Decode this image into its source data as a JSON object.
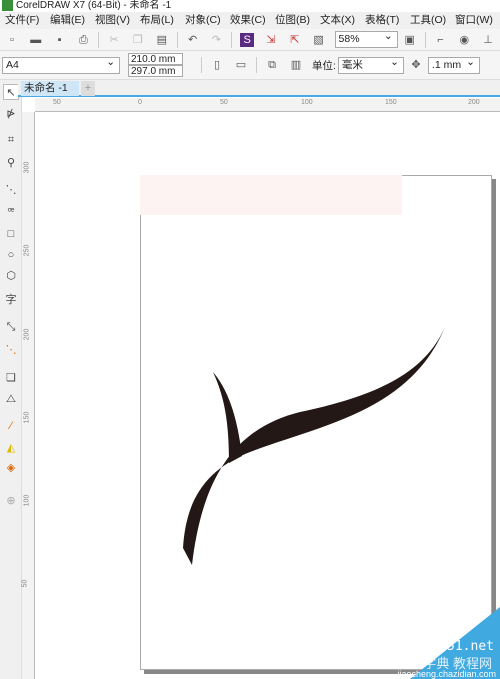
{
  "window": {
    "title": "CorelDRAW X7 (64-Bit) - 未命名 -1"
  },
  "menu": [
    "文件(F)",
    "编辑(E)",
    "视图(V)",
    "布局(L)",
    "对象(C)",
    "效果(C)",
    "位图(B)",
    "文本(X)",
    "表格(T)",
    "工具(O)",
    "窗口(W)"
  ],
  "toolbar": {
    "zoom": "58%"
  },
  "propbar": {
    "page_size": "A4",
    "width": "210.0 mm",
    "height": "297.0 mm",
    "unit_label": "单位:",
    "unit": "毫米",
    "nudge": ".1 mm"
  },
  "tabs": [
    {
      "label": "未命名 -1"
    }
  ],
  "rulers": {
    "h": [
      "50",
      "0",
      "50",
      "100",
      "150",
      "200"
    ],
    "v": [
      "300",
      "250",
      "200",
      "150",
      "100",
      "50"
    ]
  },
  "watermark": {
    "line1": "jb51.net",
    "line2": "查字典 教程网",
    "line3": "jiaocheng.chazidian.com"
  },
  "colors": {
    "accent": "#4aa8e0",
    "shape": "#231815"
  }
}
